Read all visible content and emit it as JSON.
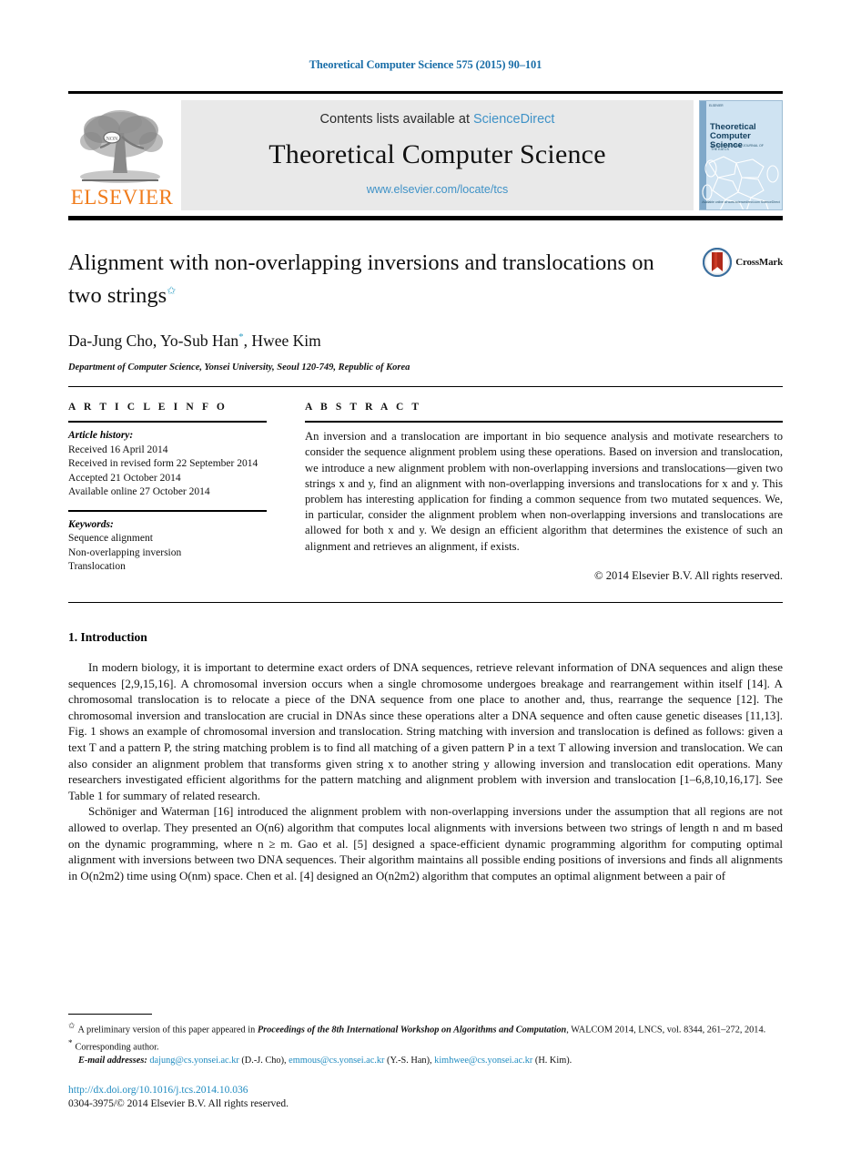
{
  "running_head": "Theoretical Computer Science 575 (2015) 90–101",
  "masthead": {
    "publisher_name": "ELSEVIER",
    "publisher_logo_alt": "elsevier-tree-logo",
    "contents_prefix": "Contents lists available at ",
    "contents_link": "ScienceDirect",
    "journal_title": "Theoretical Computer Science",
    "journal_url": "www.elsevier.com/locate/tcs",
    "cover": {
      "title_line1": "Theoretical",
      "title_line2": "Computer Science",
      "subtitle": "AN INTERNATIONAL JOURNAL OF THE EATCS",
      "footer": "Available online at www.sciencedirect.com ScienceDirect"
    }
  },
  "article": {
    "title": "Alignment with non-overlapping inversions and translocations on two strings",
    "title_footnote_mark": "✩",
    "crossmark_label": "CrossMark",
    "authors": "Da-Jung Cho, Yo-Sub Han",
    "authors_tail": ", Hwee Kim",
    "corresponding_mark": "*",
    "affiliation": "Department of Computer Science, Yonsei University, Seoul 120-749, Republic of Korea"
  },
  "info": {
    "heading": "A R T I C L E   I N F O",
    "history_label": "Article history:",
    "history": [
      "Received 16 April 2014",
      "Received in revised form 22 September 2014",
      "Accepted 21 October 2014",
      "Available online 27 October 2014"
    ],
    "keywords_label": "Keywords:",
    "keywords": [
      "Sequence alignment",
      "Non-overlapping inversion",
      "Translocation"
    ]
  },
  "abstract": {
    "heading": "A B S T R A C T",
    "text": "An inversion and a translocation are important in bio sequence analysis and motivate researchers to consider the sequence alignment problem using these operations. Based on inversion and translocation, we introduce a new alignment problem with non-overlapping inversions and translocations—given two strings x and y, find an alignment with non-overlapping inversions and translocations for x and y. This problem has interesting application for finding a common sequence from two mutated sequences. We, in particular, consider the alignment problem when non-overlapping inversions and translocations are allowed for both x and y. We design an efficient algorithm that determines the existence of such an alignment and retrieves an alignment, if exists.",
    "copyright": "© 2014 Elsevier B.V. All rights reserved."
  },
  "body": {
    "section_number": "1.",
    "section_title": "Introduction",
    "paragraph1": "In modern biology, it is important to determine exact orders of DNA sequences, retrieve relevant information of DNA sequences and align these sequences [2,9,15,16]. A chromosomal inversion occurs when a single chromosome undergoes breakage and rearrangement within itself [14]. A chromosomal translocation is to relocate a piece of the DNA sequence from one place to another and, thus, rearrange the sequence [12]. The chromosomal inversion and translocation are crucial in DNAs since these operations alter a DNA sequence and often cause genetic diseases [11,13]. Fig. 1 shows an example of chromosomal inversion and translocation. String matching with inversion and translocation is defined as follows: given a text T and a pattern P, the string matching problem is to find all matching of a given pattern P in a text T allowing inversion and translocation. We can also consider an alignment problem that transforms given string x to another string y allowing inversion and translocation edit operations. Many researchers investigated efficient algorithms for the pattern matching and alignment problem with inversion and translocation [1–6,8,10,16,17]. See Table 1 for summary of related research.",
    "paragraph2": "Schöniger and Waterman [16] introduced the alignment problem with non-overlapping inversions under the assumption that all regions are not allowed to overlap. They presented an O(n6) algorithm that computes local alignments with inversions between two strings of length n and m based on the dynamic programming, where n ≥ m. Gao et al. [5] designed a space-efficient dynamic programming algorithm for computing optimal alignment with inversions between two DNA sequences. Their algorithm maintains all possible ending positions of inversions and finds all alignments in O(n2m2) time using O(nm) space. Chen et al. [4] designed an O(n2m2) algorithm that computes an optimal alignment between a pair of"
  },
  "footnotes": {
    "fn1_mark": "✩",
    "fn1_pre": "A preliminary version of this paper appeared in ",
    "fn1_italic": "Proceedings of the 8th International Workshop on Algorithms and Computation",
    "fn1_post": ", WALCOM 2014, LNCS, vol. 8344, 261–272, 2014.",
    "fn2_mark": "*",
    "fn2_text": "Corresponding author.",
    "emails_label": "E-mail addresses:",
    "emails": [
      {
        "address": "dajung@cs.yonsei.ac.kr",
        "name": "(D.-J. Cho),"
      },
      {
        "address": "emmous@cs.yonsei.ac.kr",
        "name": "(Y.-S. Han),"
      },
      {
        "address": "kimhwee@cs.yonsei.ac.kr",
        "name": "(H. Kim)."
      }
    ]
  },
  "bottom": {
    "doi": "http://dx.doi.org/10.1016/j.tcs.2014.10.036",
    "issn": "0304-3975/© 2014 Elsevier B.V. All rights reserved."
  },
  "colors": {
    "link_blue": "#1f8bc0",
    "running_head_blue": "#1a6ea8",
    "sciencedirect_blue": "#3f92c7",
    "elsevier_orange": "#f07c1c",
    "band_gray": "#e9e9e9",
    "cover_blue": "#cfe3f2",
    "crossmark_red": "#b02a1a"
  }
}
